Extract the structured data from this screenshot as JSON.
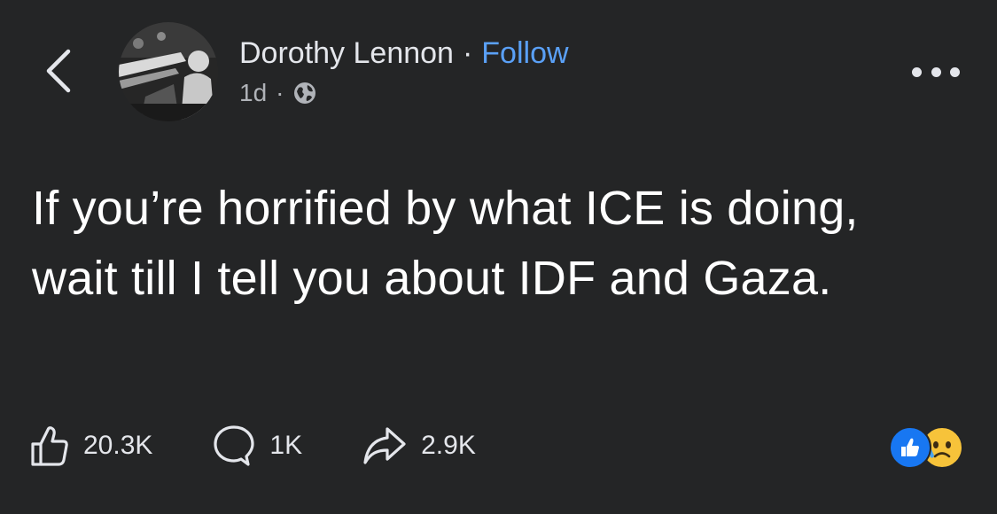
{
  "header": {
    "author_name": "Dorothy Lennon",
    "separator": "·",
    "follow_label": "Follow",
    "timestamp": "1d",
    "meta_separator": "·",
    "audience_icon": "globe-icon",
    "back_icon": "chevron-left-icon",
    "more_icon": "more-horizontal-icon"
  },
  "post": {
    "text": "If you’re horrified by what ICE is doing, wait till I tell you about IDF and Gaza."
  },
  "actions": {
    "like": {
      "icon": "thumbs-up-icon",
      "count": "20.3K"
    },
    "comment": {
      "icon": "comment-icon",
      "count": "1K"
    },
    "share": {
      "icon": "share-icon",
      "count": "2.9K"
    }
  },
  "reactions": [
    "like-reaction-icon",
    "sad-reaction-icon"
  ],
  "colors": {
    "background": "#242526",
    "text": "#e4e6eb",
    "link": "#5aa0f6",
    "like_blue": "#1877f2",
    "sad_yellow": "#f7c33a"
  }
}
